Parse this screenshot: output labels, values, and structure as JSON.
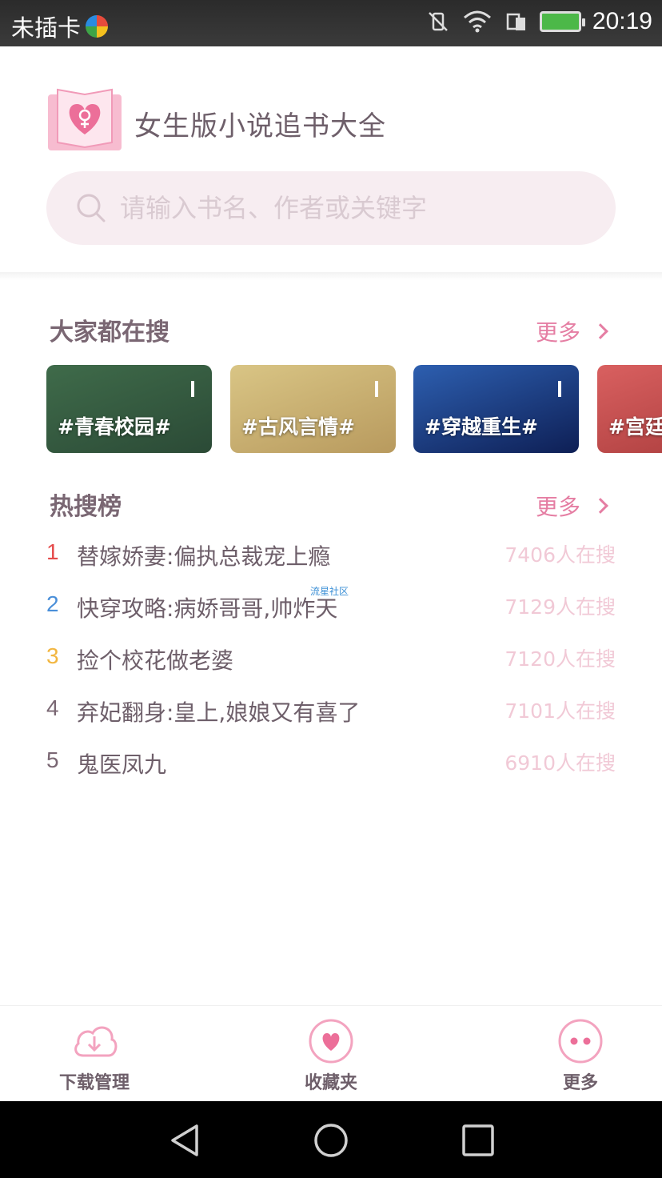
{
  "status_bar": {
    "carrier": "未插卡",
    "time": "20:19"
  },
  "header": {
    "app_title": "女生版小说追书大全",
    "search_placeholder": "请输入书名、作者或关键字"
  },
  "popular_searches": {
    "title": "大家都在搜",
    "more_label": "更多",
    "tags": [
      {
        "label": "#青春校园#",
        "bg_top": "#3f6b4a",
        "bg_bottom": "#2b4a36"
      },
      {
        "label": "#古风言情#",
        "bg_top": "#d9c585",
        "bg_bottom": "#b89a5e"
      },
      {
        "label": "#穿越重生#",
        "bg_top": "#2d5fb0",
        "bg_bottom": "#0e1f55"
      },
      {
        "label": "#宫廷",
        "bg_top": "#d96060",
        "bg_bottom": "#a83b3b"
      }
    ]
  },
  "hot_list": {
    "title": "热搜榜",
    "more_label": "更多",
    "watermark": "流星社区",
    "items": [
      {
        "rank": "1",
        "title": "替嫁娇妻:偏执总裁宠上瘾",
        "count": "7406人在搜",
        "rank_color": "#e54b4b"
      },
      {
        "rank": "2",
        "title": "快穿攻略:病娇哥哥,帅炸天",
        "count": "7129人在搜",
        "rank_color": "#4a8fd9"
      },
      {
        "rank": "3",
        "title": "捡个校花做老婆",
        "count": "7120人在搜",
        "rank_color": "#f2b640"
      },
      {
        "rank": "4",
        "title": "弃妃翻身:皇上,娘娘又有喜了",
        "count": "7101人在搜",
        "rank_color": "#7a6773"
      },
      {
        "rank": "5",
        "title": "鬼医凤九",
        "count": "6910人在搜",
        "rank_color": "#7a6773"
      }
    ]
  },
  "bottom_nav": {
    "items": [
      {
        "label": "下载管理",
        "icon": "download-cloud-icon"
      },
      {
        "label": "收藏夹",
        "icon": "heart-icon"
      },
      {
        "label": "更多",
        "icon": "more-dots-icon"
      }
    ]
  },
  "colors": {
    "accent_pink": "#e57ea3",
    "text_main": "#6e5f6a",
    "search_bg": "#f7edf1"
  }
}
